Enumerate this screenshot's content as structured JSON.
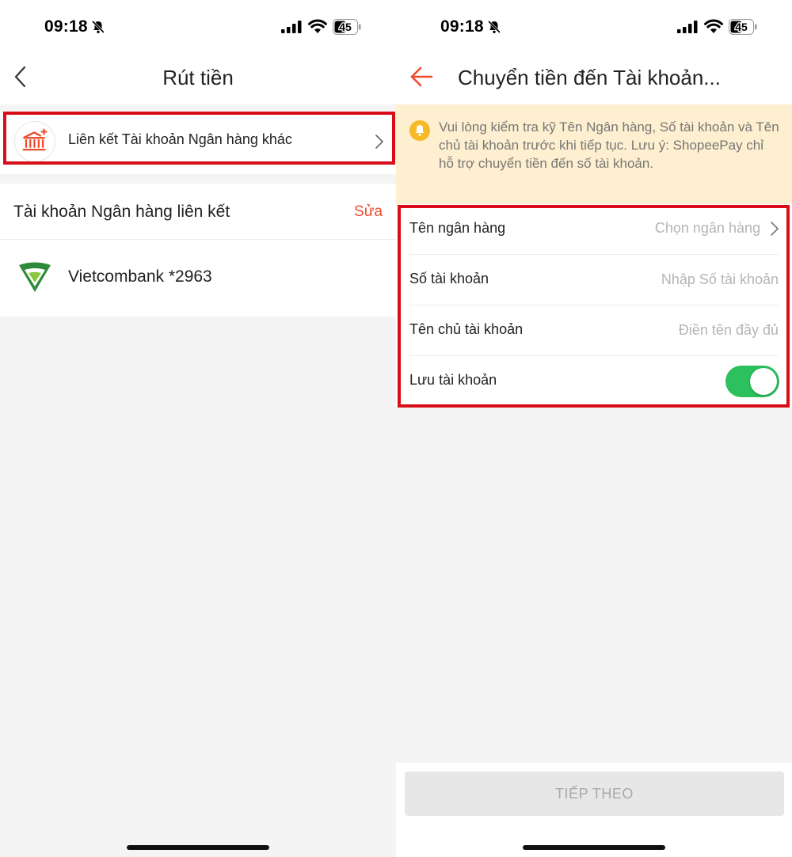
{
  "colors": {
    "accent": "#ee4d2d",
    "highlight_frame": "#d80d17",
    "notice_bg": "#fdefcf",
    "toggle_on": "#2cc05e",
    "vietcombank_green": "#2e8b3a"
  },
  "left_screen": {
    "status_bar": {
      "time": "09:18",
      "battery": "45"
    },
    "nav": {
      "title": "Rút tiền"
    },
    "link_bank_row": {
      "label": "Liên kết Tài khoản Ngân hàng khác",
      "icon": "bank-add-icon"
    },
    "linked_accounts": {
      "title": "Tài khoản Ngân hàng liên kết",
      "edit_label": "Sửa",
      "items": [
        {
          "name": "Vietcombank *2963",
          "icon": "vietcombank-logo"
        }
      ]
    }
  },
  "right_screen": {
    "status_bar": {
      "time": "09:18",
      "battery": "45"
    },
    "nav": {
      "title": "Chuyển tiền đến Tài khoản..."
    },
    "notice": {
      "text": "Vui lòng kiểm tra kỹ Tên Ngân hàng, Số tài khoản và Tên chủ tài khoản trước khi tiếp tục. Lưu ý: ShopeePay chỉ hỗ trợ chuyển tiền đến số tài khoản.",
      "icon": "bell-icon"
    },
    "form": {
      "bank_name": {
        "label": "Tên ngân hàng",
        "placeholder": "Chọn ngân hàng"
      },
      "account_number": {
        "label": "Số tài khoản",
        "placeholder": "Nhập Số tài khoản",
        "value": ""
      },
      "holder_name": {
        "label": "Tên chủ tài khoản",
        "placeholder": "Điền tên đầy đủ",
        "value": ""
      },
      "save_account": {
        "label": "Lưu tài khoản",
        "on": true
      }
    },
    "next_button": {
      "label": "TIẾP THEO",
      "enabled": false
    }
  }
}
